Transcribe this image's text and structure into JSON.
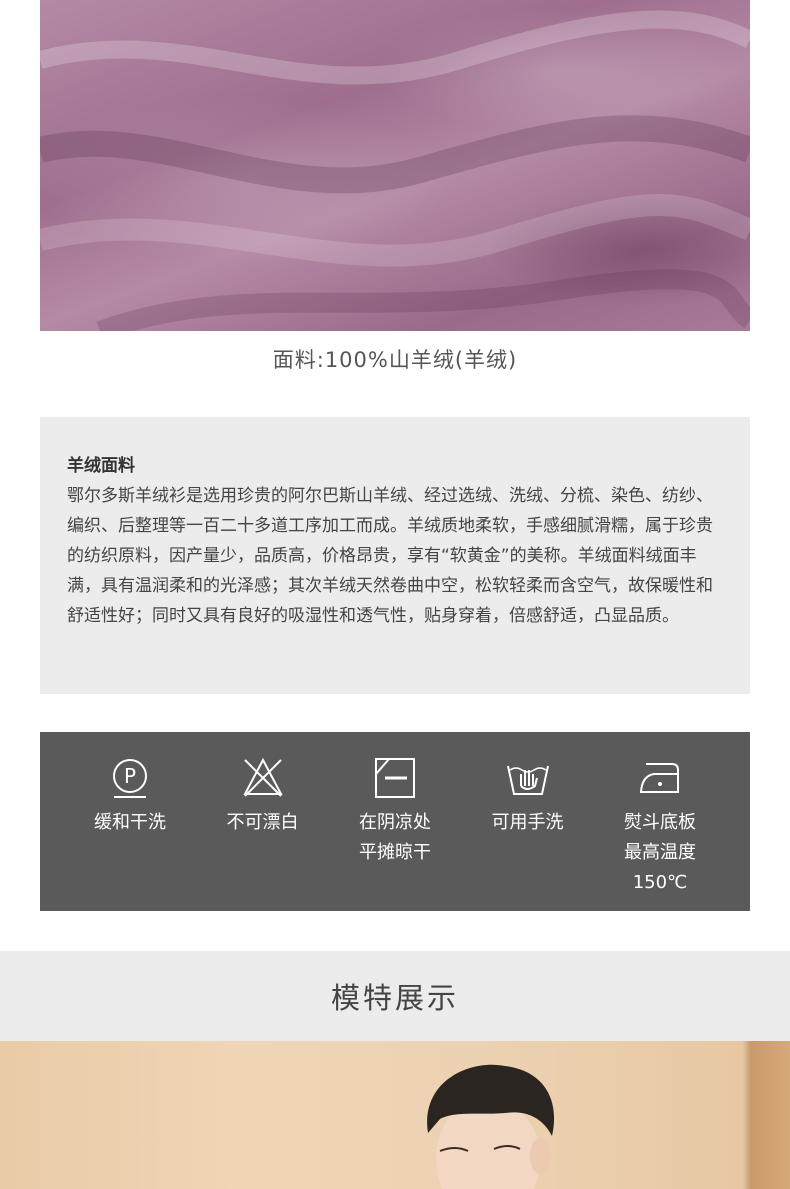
{
  "fabric_caption": "面料:100%山羊绒(羊绒)",
  "description": {
    "title": "羊绒面料",
    "body": "鄂尔多斯羊绒衫是选用珍贵的阿尔巴斯山羊绒、经过选绒、洗绒、分梳、染色、纺纱、编织、后整理等一百二十多道工序加工而成。羊绒质地柔软，手感细腻滑糯，属于珍贵的纺织原料，因产量少，品质高，价格昂贵，享有“软黄金”的美称。羊绒面料绒面丰满，具有温润柔和的光泽感；其次羊绒天然卷曲中空，松软轻柔而含空气，故保暖性和舒适性好；同时又具有良好的吸湿性和透气性，贴身穿着，倍感舒适，凸显品质。"
  },
  "care": [
    {
      "icon": "dry-clean-p-icon",
      "label": "缓和干洗"
    },
    {
      "icon": "no-bleach-icon",
      "label": "不可漂白"
    },
    {
      "icon": "dry-flat-shade-icon",
      "label": "在阴凉处\n平摊晾干"
    },
    {
      "icon": "hand-wash-icon",
      "label": "可用手洗"
    },
    {
      "icon": "iron-icon",
      "label": "熨斗底板\n最高温度\n150℃"
    }
  ],
  "model_section_title": "模特展示"
}
